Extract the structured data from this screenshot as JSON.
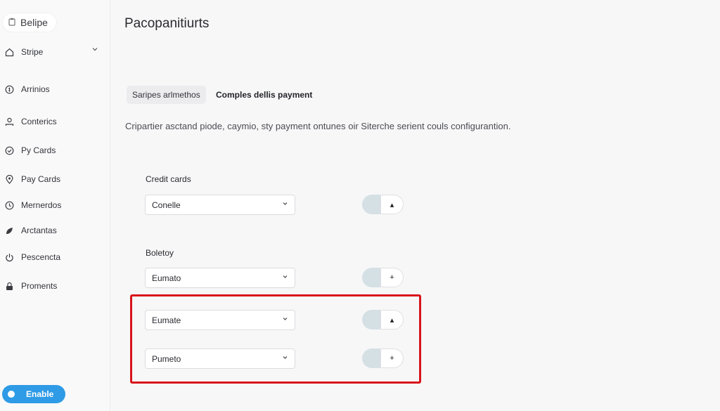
{
  "brand": {
    "label": "Belipe",
    "icon": "clipboard-icon"
  },
  "sidebar": {
    "items": [
      {
        "label": "Stripe",
        "icon": "home-icon",
        "expandable": true
      },
      {
        "label": "Arrinios",
        "icon": "coin-icon"
      },
      {
        "label": "Conterics",
        "icon": "user-icon"
      },
      {
        "label": "Py Cards",
        "icon": "check-circle-icon"
      },
      {
        "label": "Pay Cards",
        "icon": "location-pin-icon"
      },
      {
        "label": "Mernerdos",
        "icon": "clock-icon"
      },
      {
        "label": "Arctantas",
        "icon": "leaf-icon"
      },
      {
        "label": "Pescencta",
        "icon": "power-icon"
      },
      {
        "label": "Proments",
        "icon": "lock-icon"
      }
    ],
    "enable_label": "Enable"
  },
  "main": {
    "title": "Pacopanitiurts",
    "tabs": [
      {
        "label": "Saripes arlmethos",
        "active": true
      },
      {
        "label": "Comples dellis payment",
        "active": false
      }
    ],
    "description": "Cripartier asctand piode, caymio, sty payment ontunes oir Siterche serient couls configurantion.",
    "sections": [
      {
        "label": "Credit cards",
        "rows": [
          {
            "value": "Conelle",
            "toggle_symbol": "▴"
          }
        ]
      },
      {
        "label": "Boletoy",
        "rows": [
          {
            "value": "Eumato",
            "toggle_symbol": "+"
          },
          {
            "value": "Eumate",
            "toggle_symbol": "▴"
          },
          {
            "value": "Pumeto",
            "toggle_symbol": "+"
          }
        ]
      }
    ]
  },
  "colors": {
    "accent": "#2f9be6",
    "highlight": "#d8141b",
    "toggle_track": "#d5e0e5"
  }
}
